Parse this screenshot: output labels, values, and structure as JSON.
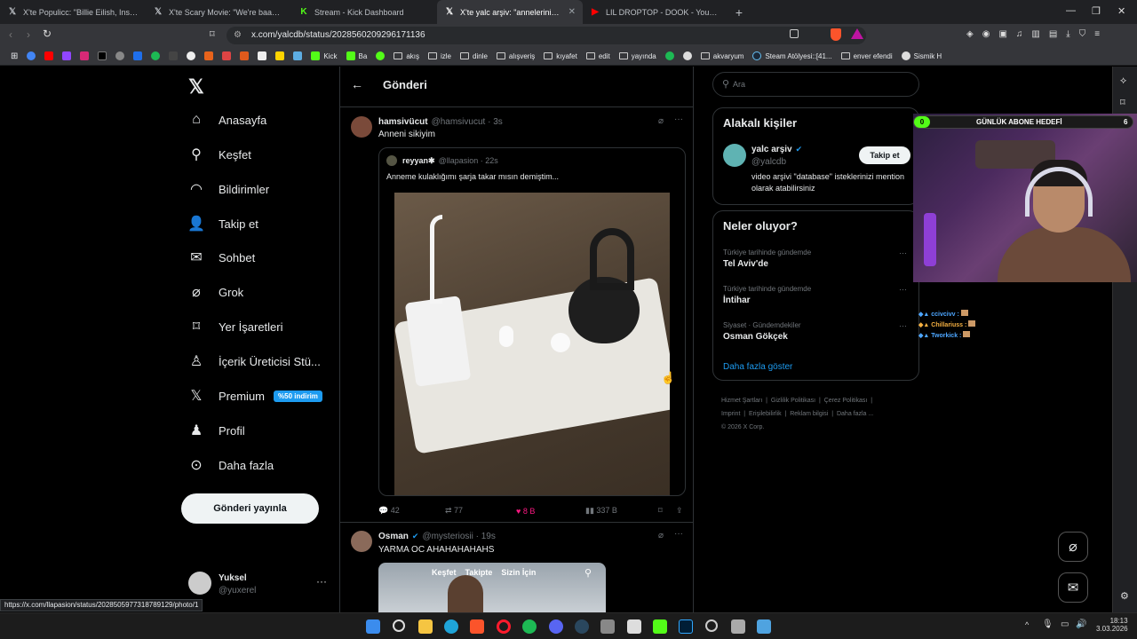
{
  "browser": {
    "tabs": [
      {
        "title": "X'te Populicc: \"Billie Eilish, Instagram",
        "icon": "x-logo"
      },
      {
        "title": "X'te Scary Movie: \"We're baaaaaack",
        "icon": "x-logo"
      },
      {
        "title": "Stream - Kick Dashboard",
        "icon": "kick-logo"
      },
      {
        "title": "X'te yalc arşiv: \"annelerinin doğu",
        "icon": "x-logo",
        "active": true
      },
      {
        "title": "LIL DROPTOP - DOOK - YouTube",
        "icon": "youtube-logo"
      }
    ],
    "url": "x.com/yalcdb/status/2028560209296171136",
    "bookmarks": [
      "Kick",
      "Ba",
      "akış",
      "izle",
      "dinle",
      "alışveriş",
      "kıyafet",
      "edit",
      "yayında",
      "akvaryum",
      "Steam Atölyesi::[41...",
      "enver efendi",
      "Sismik H"
    ],
    "status_url": "https://x.com/llapasion/status/2028505977318789129/photo/1"
  },
  "nav": {
    "items": [
      {
        "label": "Anasayfa",
        "icon": "home-icon"
      },
      {
        "label": "Keşfet",
        "icon": "search-icon"
      },
      {
        "label": "Bildirimler",
        "icon": "bell-icon"
      },
      {
        "label": "Takip et",
        "icon": "add-user-icon"
      },
      {
        "label": "Sohbet",
        "icon": "mail-icon"
      },
      {
        "label": "Grok",
        "icon": "grok-icon"
      },
      {
        "label": "Yer İşaretleri",
        "icon": "bookmark-icon"
      },
      {
        "label": "İçerik Üreticisi Stü...",
        "icon": "creator-icon"
      },
      {
        "label": "Premium",
        "icon": "x-logo-icon"
      },
      {
        "label": "Profil",
        "icon": "profile-icon"
      },
      {
        "label": "Daha fazla",
        "icon": "more-circle-icon"
      }
    ],
    "premium_badge": "%50 indirim",
    "post_button": "Gönderi yayınla",
    "account": {
      "name": "Yuksel",
      "handle": "@yuxerel"
    }
  },
  "main": {
    "title": "Gönderi",
    "tweet1": {
      "name": "hamsivücut",
      "handle": "@hamsivucut · 3s",
      "text": "Anneni sikiyim",
      "quoted": {
        "name": "reyyan✱",
        "handle": "@llapasion · 22s",
        "text": "Anneme kulaklığımı şarja takar mısın demiştim..."
      },
      "stats": {
        "replies": "42",
        "reposts": "77",
        "likes": "8 B",
        "views": "337 B"
      }
    },
    "tweet2": {
      "name": "Osman",
      "handle": "@mysteriosii · 19s",
      "text": "YARMA OC AHAHAHAHAHS",
      "video_tabs": [
        "Keşfet",
        "Takipte",
        "Sizin İçin"
      ]
    }
  },
  "right": {
    "search_placeholder": "Ara",
    "related": {
      "title": "Alakalı kişiler",
      "name": "yalc arşiv",
      "handle": "@yalcdb",
      "bio": "video arşivi \"database\" isteklerinizi mention olarak atabilirsiniz",
      "follow": "Takip et"
    },
    "trends": {
      "title": "Neler oluyor?",
      "items": [
        {
          "context": "Türkiye tarihinde gündemde",
          "name": "Tel Aviv'de"
        },
        {
          "context": "Türkiye tarihinde gündemde",
          "name": "İntihar"
        },
        {
          "context": "Siyaset · Gündemdekiler",
          "name": "Osman Gökçek"
        }
      ],
      "more": "Daha fazla göster"
    },
    "footer": {
      "links": [
        "Hizmet Şartları",
        "Gizlilik Politikası",
        "Çerez Politikası",
        "Imprint",
        "Erişilebilirlik",
        "Reklam bilgisi",
        "Daha fazla ..."
      ],
      "copyright": "© 2026 X Corp."
    }
  },
  "overlay": {
    "goal_label": "GÜNLÜK ABONE HEDEFİ",
    "goal_current": "0",
    "goal_target": "6",
    "chat": [
      {
        "user": "ccivcivv :",
        "color": "#4da6ff"
      },
      {
        "user": "Chillariuss :",
        "color": "#f5b041"
      },
      {
        "user": "Tworkick :",
        "color": "#4da6ff"
      }
    ]
  },
  "taskbar": {
    "time": "18:13",
    "date": "3.03.2026"
  },
  "colors": {
    "accent": "#1d9bf0",
    "like": "#f91880",
    "kick": "#53fc18"
  }
}
